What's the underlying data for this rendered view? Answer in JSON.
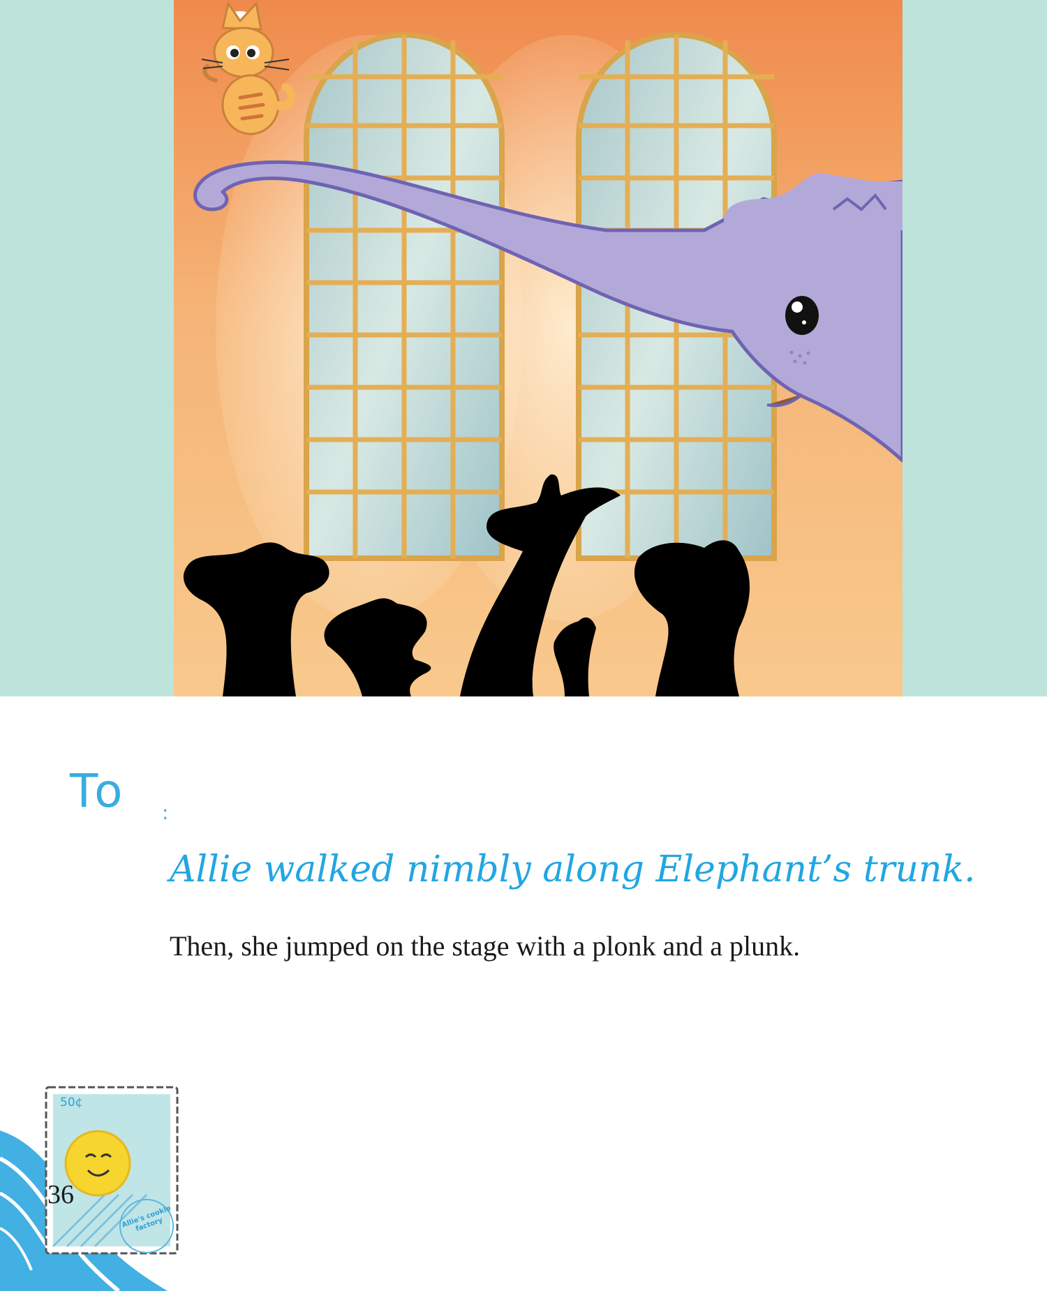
{
  "page": {
    "background_band_color": "#bde3db",
    "accent_color": "#22a6e2"
  },
  "illustration": {
    "description_icon": "elephant-kitten-silhouette-illustration"
  },
  "text": {
    "to_label": "To",
    "to_colon": ":",
    "headline": "Allie walked nimbly along Elephant’s trunk.",
    "body": "Then, she jumped on the stage with a plonk and a plunk."
  },
  "stamp": {
    "value": "50¢",
    "caption": "Allie's cookie factory",
    "icon": "smiley-sun-icon"
  },
  "page_number": "36"
}
